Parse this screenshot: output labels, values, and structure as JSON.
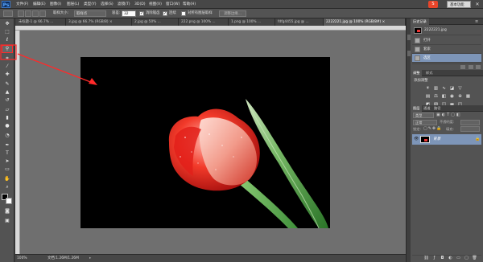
{
  "app": {
    "logo": "Ps"
  },
  "menu": [
    "文件(F)",
    "编辑(E)",
    "图像(I)",
    "图层(L)",
    "类型(Y)",
    "选择(S)",
    "滤镜(T)",
    "3D(D)",
    "视图(V)",
    "窗口(W)",
    "帮助(H)"
  ],
  "preset": "基本功能",
  "options": {
    "mode_label": "取样大小:",
    "mode_value": "取样点",
    "tolerance_label": "容差:",
    "tolerance_value": "32",
    "antialias_label": "消除锯齿",
    "contiguous_label": "连续",
    "sample_all_label": "对所有图层取样",
    "refine_button": "调整边缘..."
  },
  "tabs": [
    {
      "label": "未标题-1 @ 66.7% ..."
    },
    {
      "label": "3.jpg @ 66.7% (RGB/8) ×"
    },
    {
      "label": "2.jpg @ 50% ..."
    },
    {
      "label": "222.png @ 100% ..."
    },
    {
      "label": "1.png @ 100% ..."
    },
    {
      "label": "fdfg4455.jpg @ ..."
    },
    {
      "label": "2222221.jpg @ 100% (RGB/8#) ×"
    }
  ],
  "status": {
    "zoom": "100%",
    "doc": "文档:1.26M/1.26M"
  },
  "panels": {
    "top_tabs": [
      "历史记录"
    ],
    "doc_name": "2222221.jpg",
    "history": [
      "打开",
      "套索",
      "选区"
    ],
    "adj_tabs": [
      "调整",
      "样式"
    ],
    "adj_title": "添加调整",
    "layer_tabs": [
      "图层",
      "通道",
      "路径"
    ],
    "kind": "类型",
    "blend": "正常",
    "opacity_label": "不透明度:",
    "lock_label": "锁定:",
    "fill_label": "填充:",
    "layer_name": "背景"
  },
  "colors": {
    "accent": "#7d95b8",
    "highlight_box": "#ff2a2a"
  }
}
